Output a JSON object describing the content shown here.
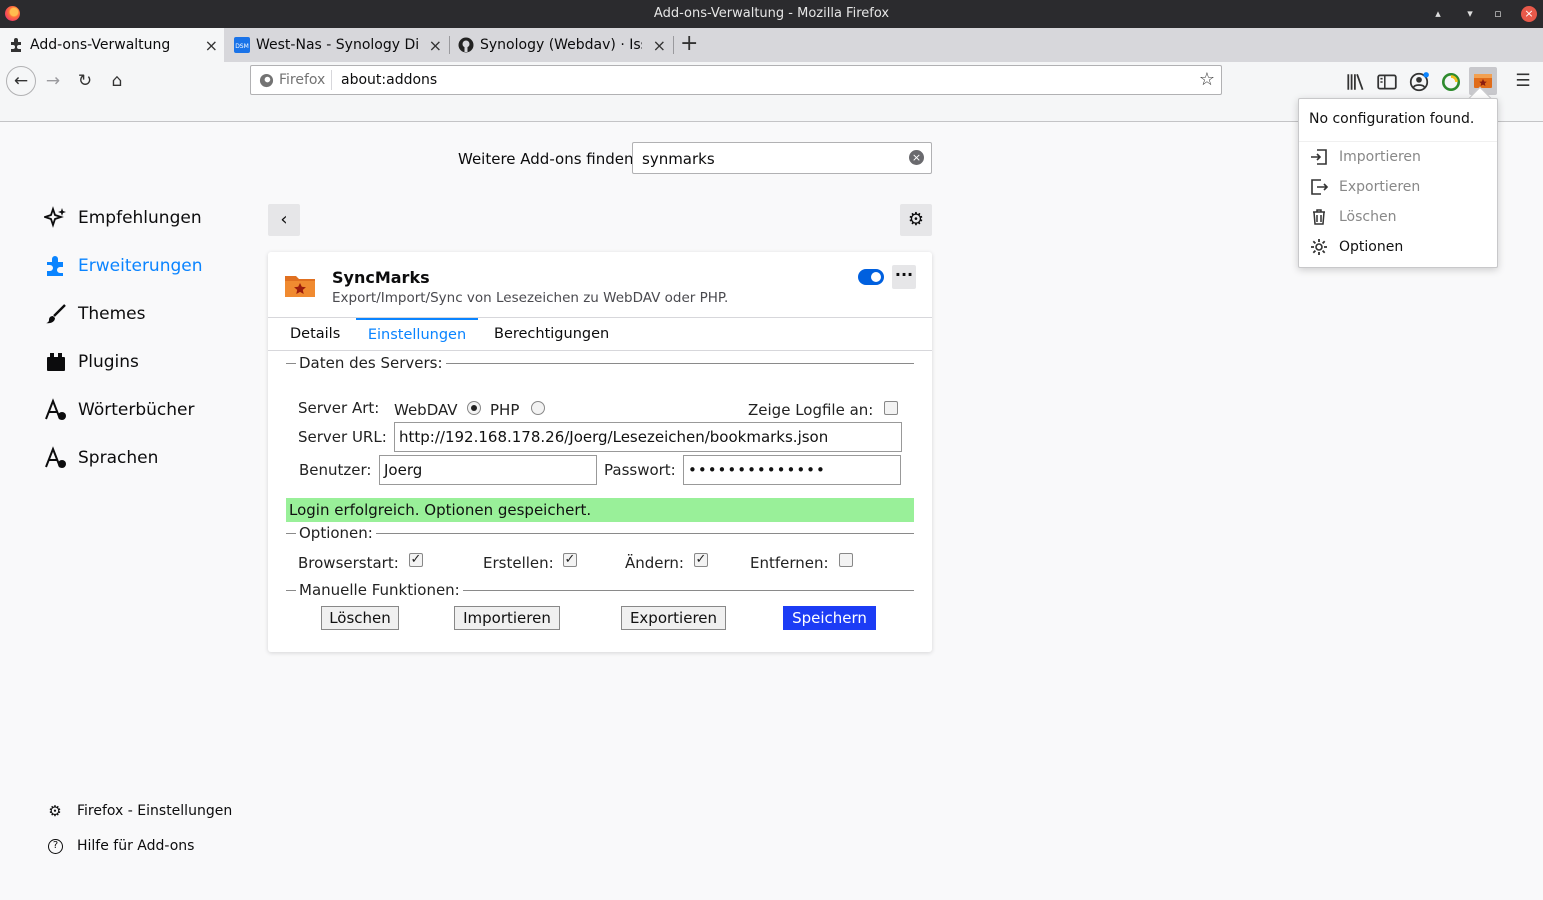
{
  "window": {
    "title": "Add-ons-Verwaltung - Mozilla Firefox",
    "min": "▴",
    "max": "▾",
    "restore": "▫",
    "close": "×"
  },
  "tabs": [
    {
      "label": "Add-ons-Verwaltung",
      "close": "×"
    },
    {
      "label": "West-Nas - Synology Disk",
      "close": "×"
    },
    {
      "label": "Synology (Webdav) · Issu",
      "close": "×"
    },
    {
      "label": "+"
    }
  ],
  "nav": {
    "identity": "Firefox",
    "url": "about:addons",
    "back": "←",
    "forward": "→",
    "reload": "↻",
    "home": "⌂",
    "bookmark_star": "☆",
    "menu": "☰"
  },
  "find": {
    "label": "Weitere Add-ons finden",
    "value": "synmarks",
    "clear": "×"
  },
  "categories": [
    {
      "label": "Empfehlungen",
      "icon": "sparkle-icon"
    },
    {
      "label": "Erweiterungen",
      "icon": "puzzle-icon"
    },
    {
      "label": "Themes",
      "icon": "brush-icon"
    },
    {
      "label": "Plugins",
      "icon": "plugin-icon"
    },
    {
      "label": "Wörterbücher",
      "icon": "dictionary-icon"
    },
    {
      "label": "Sprachen",
      "icon": "language-icon"
    }
  ],
  "footer": [
    {
      "label": "Firefox - Einstellungen",
      "icon": "⚙"
    },
    {
      "label": "Hilfe für Add-ons",
      "icon": "?"
    }
  ],
  "controls": {
    "back": "‹",
    "gear": "⚙"
  },
  "addon": {
    "name": "SyncMarks",
    "description": "Export/Import/Sync von Lesezeichen zu WebDAV oder PHP.",
    "more": "···",
    "tabs": [
      "Details",
      "Einstellungen",
      "Berechtigungen"
    ]
  },
  "settings": {
    "server_legend": "Daten des Servers:",
    "server_type_label": "Server Art:",
    "webdav_label": "WebDAV",
    "php_label": "PHP",
    "logfile_label": "Zeige Logfile an:",
    "url_label": "Server URL:",
    "url_value": "http://192.168.178.26/Joerg/Lesezeichen/bookmarks.json",
    "user_label": "Benutzer:",
    "user_value": "Joerg",
    "password_label": "Passwort:",
    "password_value": "••••••••••••••",
    "status": "Login erfolgreich. Optionen gespeichert.",
    "options_legend": "Optionen:",
    "opt_start": "Browserstart:",
    "opt_create": "Erstellen:",
    "opt_change": "Ändern:",
    "opt_remove": "Entfernen:",
    "check": "✓",
    "manual_legend": "Manuelle Funktionen:",
    "btn_delete": "Löschen",
    "btn_import": "Importieren",
    "btn_export": "Exportieren",
    "btn_save": "Speichern"
  },
  "popup": {
    "message": "No configuration found.",
    "items": [
      {
        "label": "Importieren",
        "icon": "import-icon"
      },
      {
        "label": "Exportieren",
        "icon": "export-icon"
      },
      {
        "label": "Löschen",
        "icon": "trash-icon"
      },
      {
        "label": "Optionen",
        "icon": "gear-icon"
      }
    ]
  },
  "colors": {
    "accent": "#0a84ff",
    "success": "#99f099",
    "save_button": "#1c3cf5"
  }
}
